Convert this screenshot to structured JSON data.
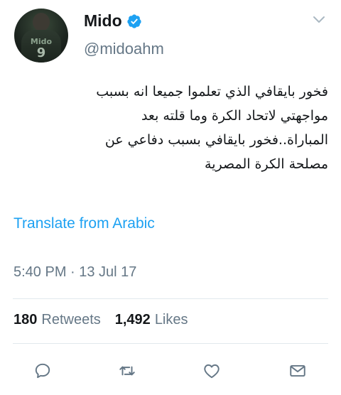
{
  "user": {
    "display_name": "Mido",
    "handle": "@midoahm",
    "verified": true,
    "avatar_text": "Mido",
    "avatar_number": "9"
  },
  "tweet": {
    "lines": [
      "فخور بايقافي الذي تعلموا جميعا انه بسبب",
      "مواجهتي لاتحاد الكرة وما قلته بعد",
      "المباراة..فخور بايقافي بسبب دفاعي عن",
      "مصلحة الكرة المصرية"
    ],
    "translate_label": "Translate from Arabic",
    "timestamp": "5:40 PM · 13 Jul 17"
  },
  "stats": {
    "retweets_count": "180",
    "retweets_label": "Retweets",
    "likes_count": "1,492",
    "likes_label": "Likes"
  },
  "icons": {
    "reply": "reply-icon",
    "retweet": "retweet-icon",
    "like": "heart-icon",
    "message": "envelope-icon",
    "verified": "verified-badge-icon",
    "menu": "chevron-down-icon"
  },
  "colors": {
    "accent": "#1da1f2",
    "secondary_text": "#657786",
    "primary_text": "#14171a",
    "icon": "#657786"
  }
}
